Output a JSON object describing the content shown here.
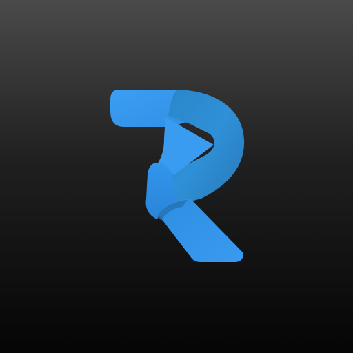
{
  "app_icon": {
    "logo_letter": "R",
    "icon": "r-ribbon-logo-icon"
  },
  "colors": {
    "background_top": "#4a4a4a",
    "background_bottom": "#050505",
    "logo_light": "#3a9cf0",
    "logo_mid": "#2c88e0",
    "logo_dark": "#2a7fb8"
  }
}
